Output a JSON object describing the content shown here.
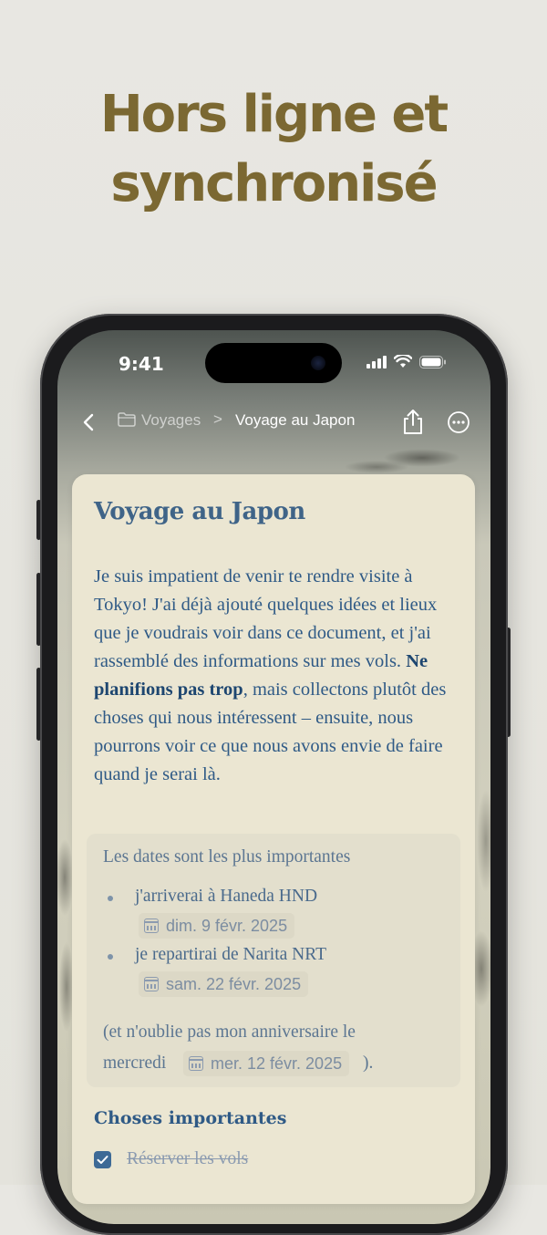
{
  "headline": {
    "line1": "Hors ligne et",
    "line2": "synchronisé"
  },
  "status_bar": {
    "time": "9:41",
    "icons": [
      "signal-icon",
      "wifi-icon",
      "battery-icon"
    ]
  },
  "nav": {
    "back_icon": "chevron-left-icon",
    "parent_folder": "Voyages",
    "separator": ">",
    "current": "Voyage au Japon",
    "share_icon": "share-icon",
    "more_icon": "ellipsis-circle-icon"
  },
  "doc": {
    "title": "Voyage au Japon",
    "body_before": "Je suis impatient de venir te rendre visite à Tokyo! J'ai déjà ajouté quelques idées et lieux que je voudrais voir dans ce document, et j'ai rassemblé des informations sur mes vols. ",
    "body_bold": "Ne planifions pas trop",
    "body_after": ", mais collectons plutôt des choses qui nous intéressent – ensuite, nous pourrons voir ce que nous avons envie de faire quand je serai là."
  },
  "callout": {
    "title": "Les dates sont les plus importantes",
    "items": [
      {
        "text": "j'arriverai à Haneda HND",
        "date": "dim. 9 févr. 2025"
      },
      {
        "text": "je repartirai de Narita NRT",
        "date": "sam. 22 févr. 2025"
      }
    ],
    "note_line1": "(et n'oublie pas mon anniversaire le",
    "note_prefix": "mercredi",
    "note_date": "mer. 12 févr. 2025",
    "note_suffix": ")."
  },
  "section": {
    "title": "Choses importantes",
    "checklist": [
      {
        "label": "Réserver les vols",
        "checked": true
      }
    ]
  },
  "colors": {
    "headline": "#7b6832",
    "accent": "#3d6a96",
    "card": "#ebe6d2"
  }
}
